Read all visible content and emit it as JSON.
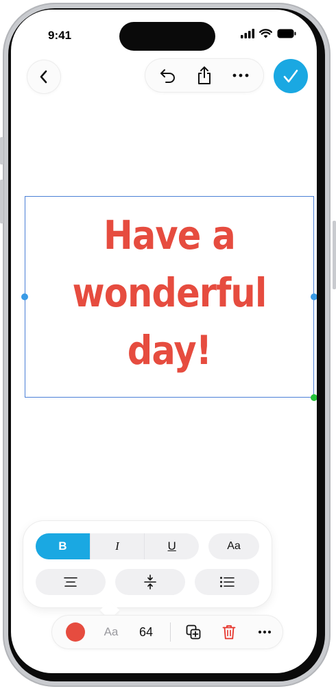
{
  "status_bar": {
    "time": "9:41"
  },
  "top_bar": {
    "back_icon": "chevron-left-icon",
    "undo_icon": "undo-icon",
    "share_icon": "share-icon",
    "more_icon": "more-horizontal-icon",
    "done_icon": "checkmark-icon"
  },
  "canvas": {
    "text_lines": [
      "Have a",
      "wonderful",
      "day!"
    ],
    "text_color": "#e64c3f",
    "selection_color": "#4a7fd6"
  },
  "format_panel": {
    "bold_label": "B",
    "italic_label": "I",
    "underline_label": "U",
    "font_label": "Aa",
    "align_icon": "align-center-icon",
    "spacing_icon": "line-spacing-icon",
    "list_icon": "bulleted-list-icon",
    "bold_active": true
  },
  "bottom_toolbar": {
    "color_value": "#e64c3f",
    "font_label": "Aa",
    "font_size": "64",
    "duplicate_icon": "duplicate-icon",
    "delete_icon": "trash-icon",
    "more_icon": "more-horizontal-icon"
  },
  "colors": {
    "accent": "#1aa8e2",
    "danger": "#e6332a"
  }
}
